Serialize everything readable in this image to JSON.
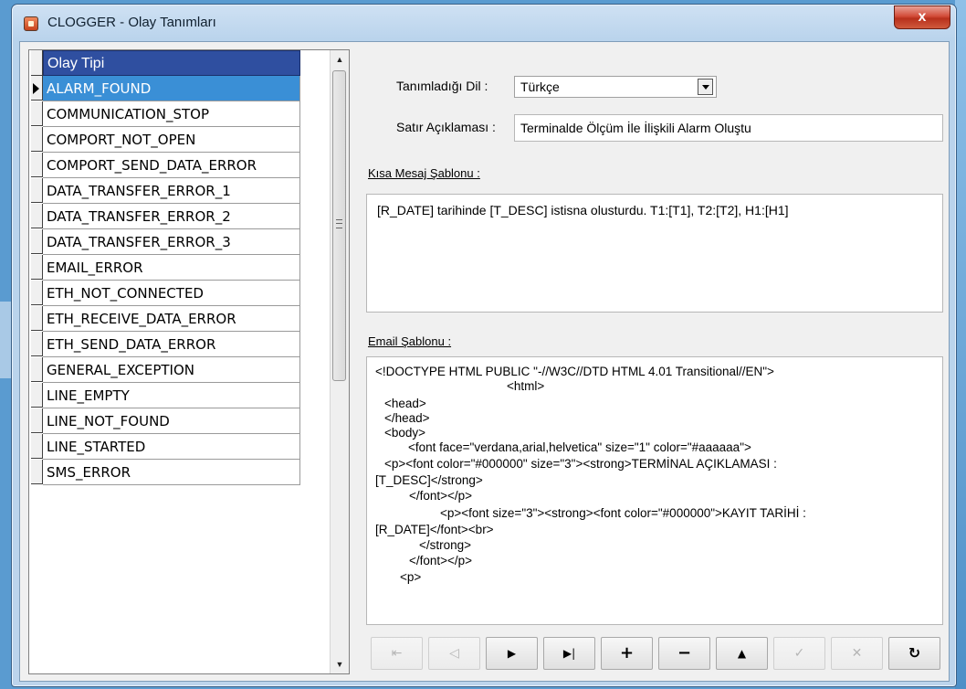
{
  "window": {
    "title": "CLOGGER - Olay Tanımları",
    "close_label": "x"
  },
  "grid": {
    "header": "Olay Tipi",
    "selected_index": 0,
    "rows": [
      "ALARM_FOUND",
      "COMMUNICATION_STOP",
      "COMPORT_NOT_OPEN",
      "COMPORT_SEND_DATA_ERROR",
      "DATA_TRANSFER_ERROR_1",
      "DATA_TRANSFER_ERROR_2",
      "DATA_TRANSFER_ERROR_3",
      "EMAIL_ERROR",
      "ETH_NOT_CONNECTED",
      "ETH_RECEIVE_DATA_ERROR",
      "ETH_SEND_DATA_ERROR",
      "GENERAL_EXCEPTION",
      "LINE_EMPTY",
      "LINE_NOT_FOUND",
      "LINE_STARTED",
      "SMS_ERROR"
    ]
  },
  "form": {
    "language_label": "Tanımladığı Dil :",
    "language_value": "Türkçe",
    "description_label": "Satır Açıklaması :",
    "description_value": "Terminalde Ölçüm İle İlişkili Alarm Oluştu",
    "sms_label": "Kısa Mesaj Şablonu :",
    "sms_value": "[R_DATE] tarihinde [T_DESC] istisna olusturdu. T1:[T1], T2:[T2], H1:[H1]",
    "email_label": "Email Şablonu :",
    "email_lines": [
      "<!DOCTYPE HTML PUBLIC \"-//W3C//DTD HTML 4.01 Transitional//EN\">",
      "<html>",
      "<head>",
      "</head>",
      "<body>",
      "<font face=\"verdana,arial,helvetica\" size=\"1\" color=\"#aaaaaa\">",
      "<p><font color=\"#000000\" size=\"3\"><strong>TERMİNAL AÇIKLAMASI :",
      "[T_DESC]</strong>",
      "</font></p>",
      "<p><font size=\"3\"><strong><font color=\"#000000\">KAYIT TARİHİ :",
      "[R_DATE]</font><br>",
      "</strong>",
      "</font></p>",
      "<p>"
    ]
  },
  "navigator": {
    "first": "⇤",
    "prior": "◁",
    "next": "▶",
    "last": "▶|",
    "insert": "+",
    "delete": "−",
    "edit": "▲",
    "post": "✓",
    "cancel": "✕",
    "refresh": "↻"
  }
}
